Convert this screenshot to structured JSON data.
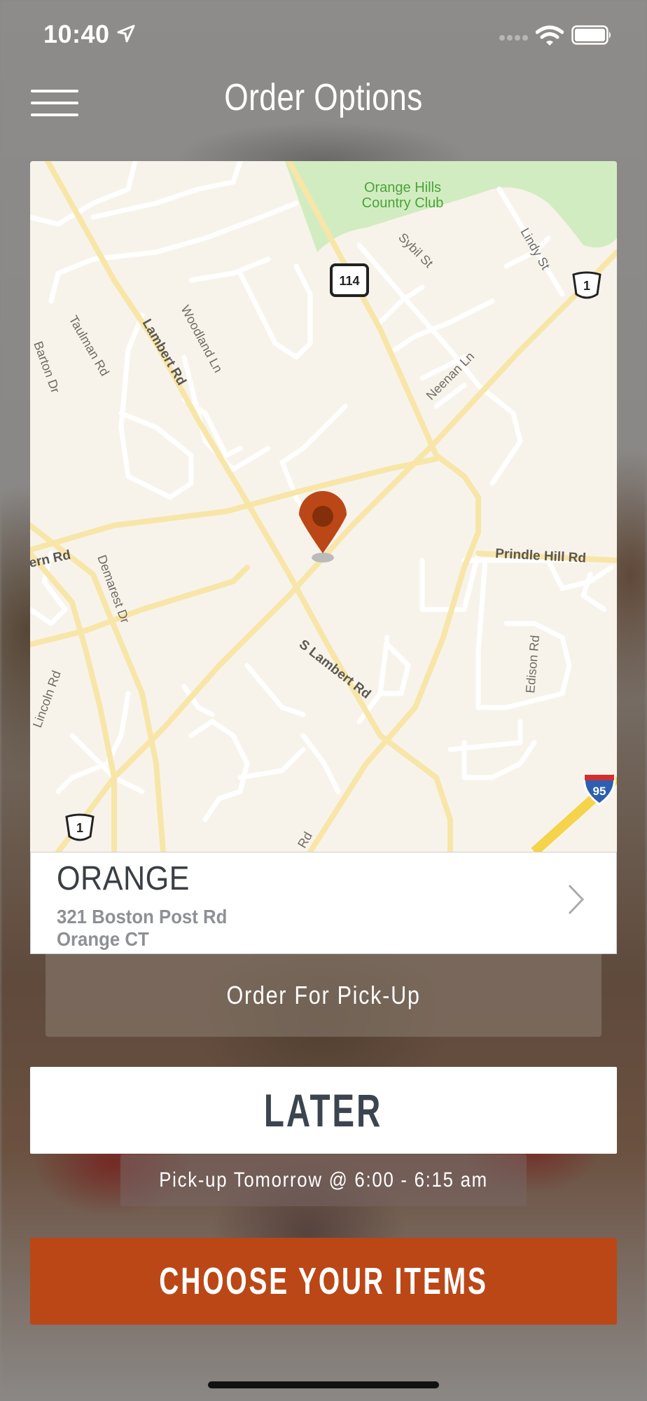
{
  "status_bar": {
    "time": "10:40"
  },
  "header": {
    "title": "Order Options"
  },
  "map": {
    "labels": {
      "golf": "Orange Hills\nCountry Club",
      "golf_line1": "Orange Hills",
      "golf_line2": "Country Club",
      "sybil": "Sybil St",
      "lindy": "Lindy St",
      "route114": "114",
      "route1_top": "1",
      "route1_bottom": "1",
      "i95": "95",
      "taulman": "Taulman Rd",
      "lambert": "Lambert Rd",
      "woodland": "Woodland Ln",
      "barton": "Barton Dr",
      "neenan": "Neenan Ln",
      "ern": "ern Rd",
      "demarest": "Demarest Dr",
      "prindle": "Prindle Hill Rd",
      "s_lambert": "S Lambert Rd",
      "lincoln": "Lincoln Rd",
      "edison": "Edison Rd",
      "rd_bottom": "Rd"
    }
  },
  "store": {
    "name": "ORANGE",
    "address_line1": "321 Boston Post Rd",
    "address_line2": "Orange CT"
  },
  "pickup_option": "Order For Pick-Up",
  "timing": {
    "label": "LATER",
    "detail": "Pick-up Tomorrow @ 6:00 - 6:15 am"
  },
  "cta": {
    "label": "CHOOSE YOUR ITEMS"
  },
  "colors": {
    "accent": "#bb4717",
    "map_bg": "#f8f3ea",
    "road": "#f7e6a8",
    "park": "#d2ecc1"
  }
}
